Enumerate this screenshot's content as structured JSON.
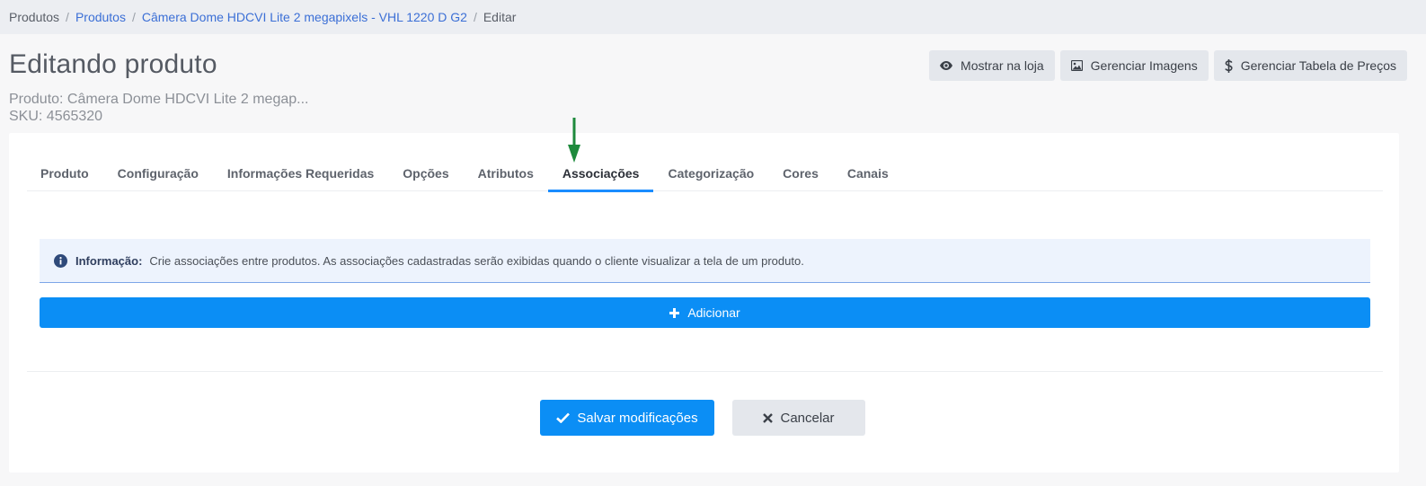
{
  "breadcrumb": {
    "items": [
      {
        "label": "Produtos",
        "link": false
      },
      {
        "label": "Produtos",
        "link": true
      },
      {
        "label": "Câmera Dome HDCVI Lite 2 megapixels - VHL 1220 D G2",
        "link": true
      },
      {
        "label": "Editar",
        "link": false
      }
    ],
    "separator": "/"
  },
  "header": {
    "title": "Editando produto",
    "product_line": "Produto: Câmera Dome HDCVI Lite 2 megap...",
    "sku_line": "SKU: 4565320"
  },
  "actions": {
    "show_store": "Mostrar na loja",
    "manage_images": "Gerenciar Imagens",
    "manage_prices": "Gerenciar Tabela de Preços"
  },
  "tabs": [
    {
      "label": "Produto"
    },
    {
      "label": "Configuração"
    },
    {
      "label": "Informações Requeridas"
    },
    {
      "label": "Opções"
    },
    {
      "label": "Atributos"
    },
    {
      "label": "Associações",
      "active": true
    },
    {
      "label": "Categorização"
    },
    {
      "label": "Cores"
    },
    {
      "label": "Canais"
    }
  ],
  "alert": {
    "title": "Informação:",
    "text": "Crie associações entre produtos. As associações cadastradas serão exibidas quando o cliente visualizar a tela de um produto."
  },
  "add_button": "Adicionar",
  "footer": {
    "save": "Salvar modificações",
    "cancel": "Cancelar"
  },
  "colors": {
    "primary": "#0b8ef5",
    "link": "#3b6fd6",
    "annotation_arrow": "#1e8a3c"
  },
  "icons": {
    "show_store": "eye-icon",
    "manage_images": "image-icon",
    "manage_prices": "dollar-icon",
    "alert": "info-circle-icon",
    "add": "plus-icon",
    "save": "check-icon",
    "cancel": "x-icon"
  }
}
